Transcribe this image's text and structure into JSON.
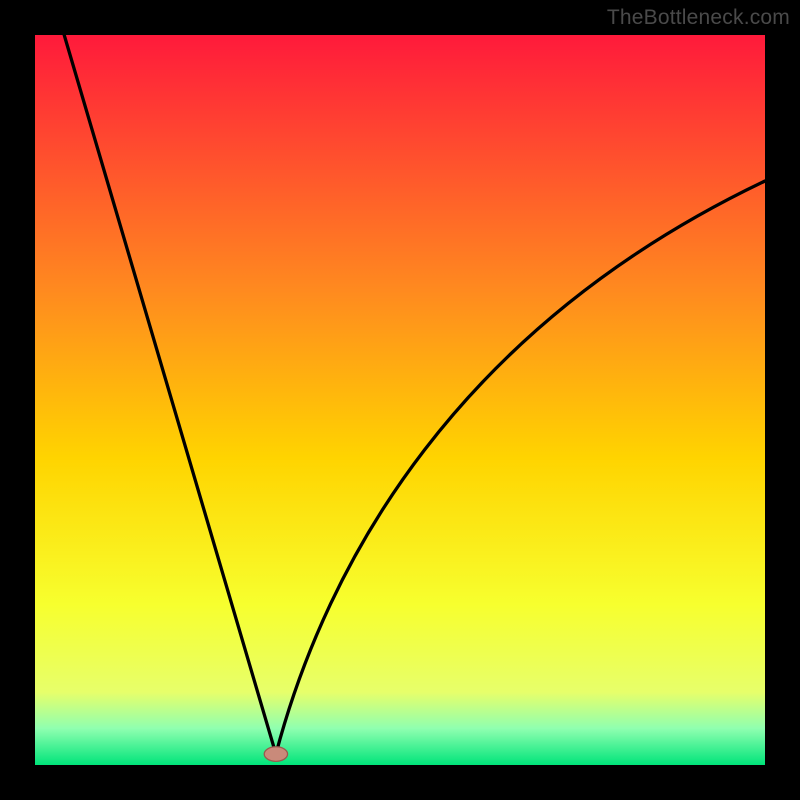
{
  "watermark": "TheBottleneck.com",
  "colors": {
    "frame": "#000000",
    "gradient_top": "#ff1a3b",
    "gradient_mid1": "#ff8a1f",
    "gradient_mid2": "#ffd400",
    "gradient_mid3": "#f7ff2e",
    "gradient_lemon": "#e7ff6a",
    "gradient_mint": "#8fffb0",
    "gradient_bottom": "#00e47a",
    "curve": "#000000",
    "marker_fill": "#c98a7a",
    "marker_stroke": "#9a5a4e"
  },
  "chart_data": {
    "type": "line",
    "title": "",
    "xlabel": "",
    "ylabel": "",
    "x_range": [
      0,
      100
    ],
    "y_range": [
      0,
      100
    ],
    "cusp_x": 33,
    "cusp_y": 1.5,
    "left_start": {
      "x": 4,
      "y": 100
    },
    "right_end": {
      "x": 100,
      "y": 80
    },
    "left_ctrl": {
      "x": 25,
      "y": 28
    },
    "right_ctrl1": {
      "x": 40,
      "y": 28
    },
    "right_ctrl2": {
      "x": 58,
      "y": 60
    },
    "marker": {
      "x": 33,
      "y": 1.5,
      "rx": 1.6,
      "ry": 1.0
    },
    "series": [
      {
        "name": "bottleneck-curve",
        "description": "V-shaped curve with cusp near x≈33",
        "points_sample": [
          {
            "x": 4,
            "y": 100
          },
          {
            "x": 10,
            "y": 80
          },
          {
            "x": 18,
            "y": 55
          },
          {
            "x": 26,
            "y": 25
          },
          {
            "x": 33,
            "y": 1.5
          },
          {
            "x": 40,
            "y": 22
          },
          {
            "x": 50,
            "y": 40
          },
          {
            "x": 65,
            "y": 57
          },
          {
            "x": 80,
            "y": 69
          },
          {
            "x": 100,
            "y": 80
          }
        ]
      }
    ]
  }
}
